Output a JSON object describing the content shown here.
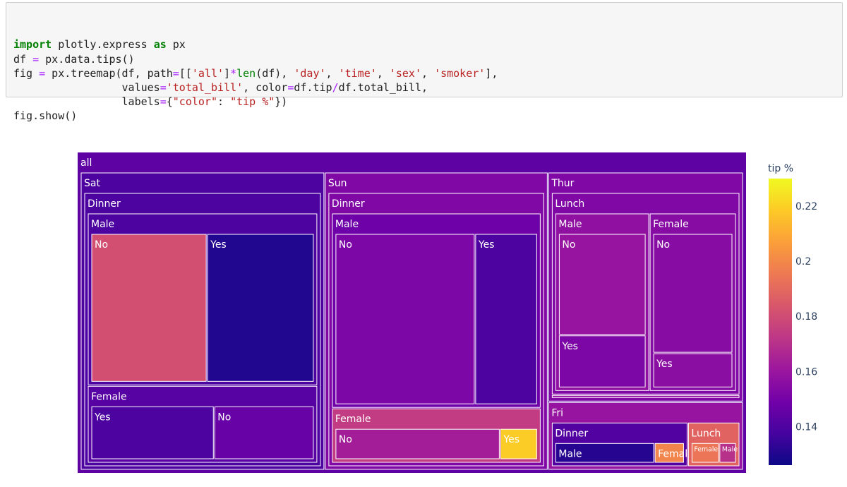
{
  "code": {
    "lines": [
      [
        {
          "t": "import",
          "c": "kw"
        },
        {
          "t": " plotly.express ",
          "c": ""
        },
        {
          "t": "as",
          "c": "kw"
        },
        {
          "t": " px",
          "c": ""
        }
      ],
      [
        {
          "t": "df ",
          "c": ""
        },
        {
          "t": "=",
          "c": "op"
        },
        {
          "t": " px.data.tips()",
          "c": ""
        }
      ],
      [
        {
          "t": "fig ",
          "c": ""
        },
        {
          "t": "=",
          "c": "op"
        },
        {
          "t": " px.treemap(df, path",
          "c": ""
        },
        {
          "t": "=",
          "c": "op"
        },
        {
          "t": "[[",
          "c": ""
        },
        {
          "t": "'all'",
          "c": "str"
        },
        {
          "t": "]",
          "c": ""
        },
        {
          "t": "*",
          "c": "op"
        },
        {
          "t": "len",
          "c": "bi"
        },
        {
          "t": "(df), ",
          "c": ""
        },
        {
          "t": "'day'",
          "c": "str"
        },
        {
          "t": ", ",
          "c": ""
        },
        {
          "t": "'time'",
          "c": "str"
        },
        {
          "t": ", ",
          "c": ""
        },
        {
          "t": "'sex'",
          "c": "str"
        },
        {
          "t": ", ",
          "c": ""
        },
        {
          "t": "'smoker'",
          "c": "str"
        },
        {
          "t": "],",
          "c": ""
        }
      ],
      [
        {
          "t": "                 values",
          "c": ""
        },
        {
          "t": "=",
          "c": "op"
        },
        {
          "t": "'total_bill'",
          "c": "str"
        },
        {
          "t": ", color",
          "c": ""
        },
        {
          "t": "=",
          "c": "op"
        },
        {
          "t": "df.tip",
          "c": ""
        },
        {
          "t": "/",
          "c": "op"
        },
        {
          "t": "df.total_bill,",
          "c": ""
        }
      ],
      [
        {
          "t": "                 labels",
          "c": ""
        },
        {
          "t": "=",
          "c": "op"
        },
        {
          "t": "{",
          "c": ""
        },
        {
          "t": "\"color\"",
          "c": "str"
        },
        {
          "t": ": ",
          "c": ""
        },
        {
          "t": "\"tip %\"",
          "c": "str"
        },
        {
          "t": "})",
          "c": ""
        }
      ],
      [
        {
          "t": "fig.show()",
          "c": ""
        }
      ]
    ]
  },
  "chart_data": {
    "type": "treemap",
    "path": [
      "all",
      "day",
      "time",
      "sex",
      "smoker"
    ],
    "color_label": "tip %",
    "colorbar": {
      "title": "tip %",
      "ticks": [
        0.14,
        0.16,
        0.18,
        0.2,
        0.22
      ],
      "range": [
        0.126,
        0.23
      ],
      "colorscale": [
        "#0d0887",
        "#46039f",
        "#7201a8",
        "#9c179e",
        "#bd3786",
        "#d8576b",
        "#ed7953",
        "#fb9f3a",
        "#fdca26",
        "#f0f921"
      ]
    },
    "root": {
      "label": "all",
      "value": 4827.77,
      "color": 0.1442,
      "children": [
        {
          "label": "Sat",
          "value": 1778.4,
          "color": 0.139,
          "children": [
            {
              "label": "Dinner",
              "value": 1778.4,
              "color": 0.139,
              "children": [
                {
                  "label": "Male",
                  "value": 1227.35,
                  "color": 0.139,
                  "children": [
                    {
                      "label": "No",
                      "value": 637.73,
                      "color": 0.181
                    },
                    {
                      "label": "Yes",
                      "value": 589.62,
                      "color": 0.13
                    }
                  ]
                },
                {
                  "label": "Female",
                  "value": 551.05,
                  "color": 0.142,
                  "children": [
                    {
                      "label": "Yes",
                      "value": 304.0,
                      "color": 0.139
                    },
                    {
                      "label": "No",
                      "value": 247.05,
                      "color": 0.146
                    }
                  ]
                }
              ]
            }
          ]
        },
        {
          "label": "Sun",
          "value": 1627.16,
          "color": 0.153,
          "children": [
            {
              "label": "Dinner",
              "value": 1627.16,
              "color": 0.153,
              "children": [
                {
                  "label": "Male",
                  "value": 1269.46,
                  "color": 0.148,
                  "children": [
                    {
                      "label": "No",
                      "value": 877.34,
                      "color": 0.152
                    },
                    {
                      "label": "Yes",
                      "value": 392.12,
                      "color": 0.139
                    }
                  ]
                },
                {
                  "label": "Female",
                  "value": 357.7,
                  "color": 0.174,
                  "children": [
                    {
                      "label": "No",
                      "value": 291.54,
                      "color": 0.163
                    },
                    {
                      "label": "Yes",
                      "value": 66.16,
                      "color": 0.219
                    }
                  ]
                }
              ]
            }
          ]
        },
        {
          "label": "Thur",
          "value": 1096.33,
          "color": 0.153,
          "children": [
            {
              "label": "Lunch",
              "value": 1077.55,
              "color": 0.153,
              "children": [
                {
                  "label": "Male",
                  "value": 561.44,
                  "color": 0.157,
                  "children": [
                    {
                      "label": "No",
                      "value": 369.73,
                      "color": 0.159
                    },
                    {
                      "label": "Yes",
                      "value": 191.71,
                      "color": 0.152
                    }
                  ]
                },
                {
                  "label": "Female",
                  "value": 516.11,
                  "color": 0.155,
                  "children": [
                    {
                      "label": "No",
                      "value": 399.78,
                      "color": 0.155
                    },
                    {
                      "label": "Yes",
                      "value": 116.33,
                      "color": 0.156
                    }
                  ]
                }
              ]
            },
            {
              "label": "",
              "value": 18.78,
              "color": 0.159,
              "children": []
            }
          ]
        },
        {
          "label": "Fri",
          "value": 325.88,
          "color": 0.159,
          "children": [
            {
              "label": "Dinner",
              "value": 235.96,
              "color": 0.141,
              "children": [
                {
                  "label": "Male",
                  "value": 181.42,
                  "color": 0.131,
                  "children": []
                },
                {
                  "label": "Female",
                  "value": 54.54,
                  "color": 0.199,
                  "children": []
                }
              ]
            },
            {
              "label": "Lunch",
              "value": 89.92,
              "color": 0.188,
              "children": [
                {
                  "label": "Female",
                  "value": 55.76,
                  "color": 0.194,
                  "children": []
                },
                {
                  "label": "Male",
                  "value": 34.16,
                  "color": 0.17,
                  "children": []
                }
              ]
            }
          ]
        }
      ]
    }
  }
}
